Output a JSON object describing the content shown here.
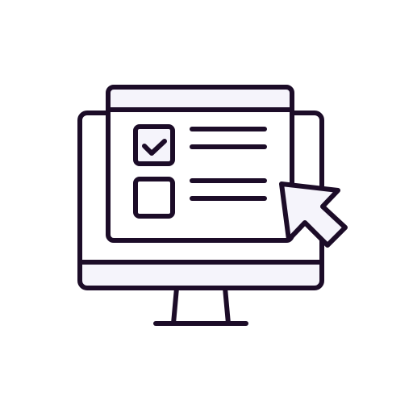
{
  "illustration": {
    "icon_name": "online-checklist-icon",
    "colors": {
      "stroke": "#1c0c28",
      "fill_light": "#f5f4fb",
      "background": "#ffffff"
    },
    "checklist": {
      "items": [
        {
          "checked": true,
          "icon": "checkmark-icon"
        },
        {
          "checked": false,
          "icon": "empty-checkbox-icon"
        }
      ]
    },
    "pointer": {
      "icon": "cursor-arrow-icon"
    }
  }
}
